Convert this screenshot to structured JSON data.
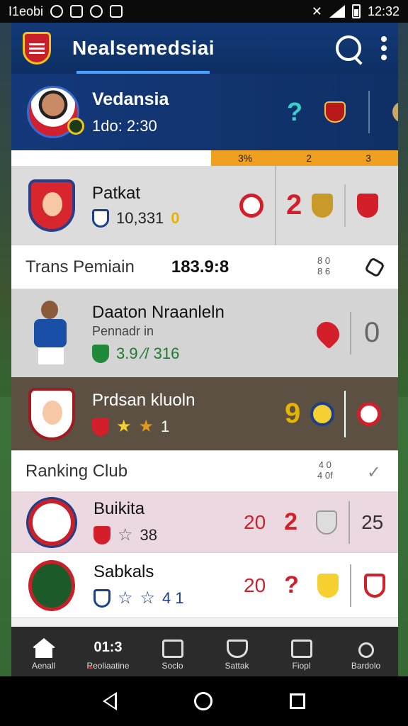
{
  "status_bar": {
    "left_text": "I1eobi",
    "time": "12:32"
  },
  "app": {
    "title": "Nealsemedsiai"
  },
  "match": {
    "name": "Vedansia",
    "time": "1do: 2:30",
    "score_mark": "?"
  },
  "strip": {
    "values": [
      "3%",
      "2",
      "3"
    ]
  },
  "team": {
    "name": "Patkat",
    "stat": "10,331",
    "stat_highlight": "0",
    "score": "2"
  },
  "trans": {
    "title": "Trans Pemiain",
    "value": "183.9:8",
    "tiny_top": "8 0",
    "tiny_bottom": "8 6"
  },
  "player1": {
    "name": "Daaton Nraanleln",
    "sub": "Pennadr in",
    "stat": "3.9 ⁄/ 316",
    "score": "0"
  },
  "player2": {
    "name": "Prdsan kluoln",
    "stat": "1",
    "score": "9"
  },
  "ranking": {
    "title": "Ranking Club",
    "tiny_top": "4 0",
    "tiny_bottom": "4 0f"
  },
  "clubs": [
    {
      "name": "Buikita",
      "stat": "38",
      "value1": "20",
      "value2": "2",
      "value3": "25"
    },
    {
      "name": "Sabkals",
      "stat": "4 1",
      "value1": "20",
      "value2": "?"
    }
  ],
  "bottom_nav": [
    {
      "label": "Aenall",
      "icon": "home-icon"
    },
    {
      "label": "Reoliaatine",
      "icon": "text-icon",
      "icon_text": "01:3"
    },
    {
      "label": "Soclo",
      "icon": "grid-icon"
    },
    {
      "label": "Sattak",
      "icon": "shield-icon"
    },
    {
      "label": "Fiopl",
      "icon": "card-icon"
    },
    {
      "label": "Bardolo",
      "icon": "search-icon"
    }
  ],
  "colors": {
    "primary": "#123a78",
    "accent": "#f0a020",
    "red": "#d21f2a"
  }
}
